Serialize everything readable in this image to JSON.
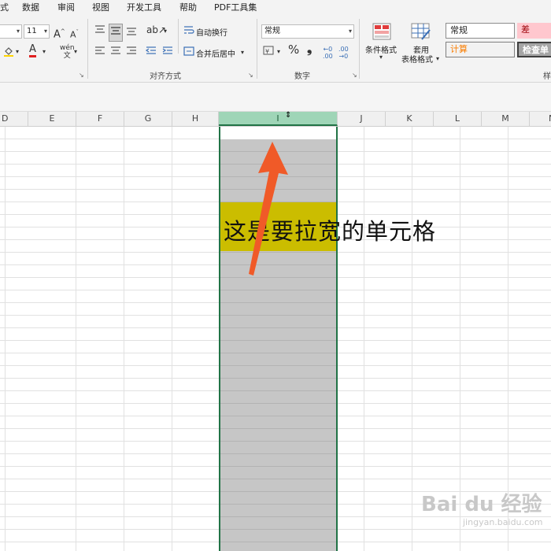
{
  "menubar": [
    "式",
    "数据",
    "审阅",
    "视图",
    "开发工具",
    "帮助",
    "PDF工具集"
  ],
  "font": {
    "size": "11",
    "grow": "A",
    "shrink": "A",
    "color_glyph": "A"
  },
  "alignment": {
    "wrap_text": "自动换行",
    "merge_center": "合并后居中",
    "group_label": "对齐方式"
  },
  "number": {
    "format": "常规",
    "percent": "%",
    "comma": "❟",
    "inc_decimal": "←.0",
    "dec_decimal": ".00→",
    "group_label": "数字"
  },
  "styles": {
    "conditional": "条件格式",
    "table_format_1": "套用",
    "table_format_2": "表格格式",
    "normal": "常规",
    "bad": "差",
    "calculation": "计算",
    "check_cell": "检查单",
    "group_label_partial": "样"
  },
  "columns": [
    "D",
    "E",
    "F",
    "G",
    "H",
    "I",
    "J",
    "K",
    "L",
    "M",
    "N"
  ],
  "cell_text": "这是要拉宽的单元格",
  "watermark": {
    "main": "Bai du 经验",
    "sub": "jingyan.baidu.com"
  },
  "colors": {
    "selection_border": "#217346",
    "highlight": "#cbbd00",
    "arrow": "#f05a28",
    "selected_header": "#9fd5b7"
  }
}
